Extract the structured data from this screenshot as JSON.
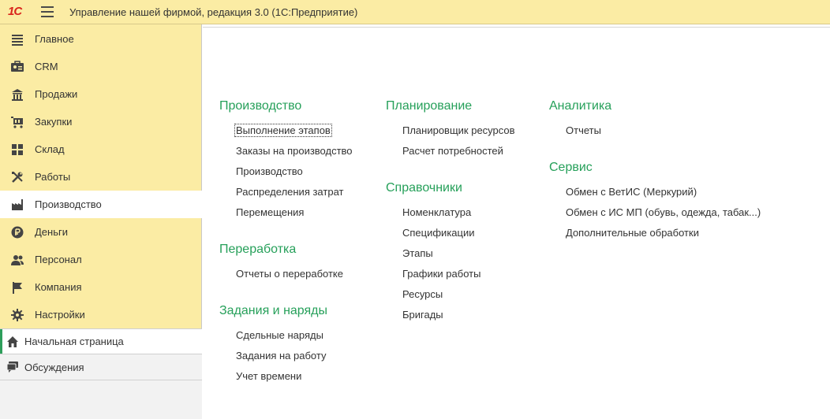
{
  "app": {
    "logo_text": "1С",
    "title": "Управление нашей фирмой, редакция 3.0  (1С:Предприятие)"
  },
  "sidebar": {
    "items": [
      {
        "label": "Главное",
        "icon": "list-icon"
      },
      {
        "label": "CRM",
        "icon": "crm-icon"
      },
      {
        "label": "Продажи",
        "icon": "store-icon"
      },
      {
        "label": "Закупки",
        "icon": "cart-icon"
      },
      {
        "label": "Склад",
        "icon": "warehouse-icon"
      },
      {
        "label": "Работы",
        "icon": "tools-icon"
      },
      {
        "label": "Производство",
        "icon": "factory-icon",
        "active": true
      },
      {
        "label": "Деньги",
        "icon": "ruble-icon"
      },
      {
        "label": "Персонал",
        "icon": "people-icon"
      },
      {
        "label": "Компания",
        "icon": "flag-icon"
      },
      {
        "label": "Настройки",
        "icon": "gear-icon"
      }
    ],
    "home_label": "Начальная страница",
    "discussions_label": "Обсуждения"
  },
  "sections": {
    "production": {
      "title": "Производство",
      "links": [
        "Выполнение этапов",
        "Заказы на производство",
        "Производство",
        "Распределения затрат",
        "Перемещения"
      ]
    },
    "processing": {
      "title": "Переработка",
      "links": [
        "Отчеты о переработке"
      ]
    },
    "tasks": {
      "title": "Задания и наряды",
      "links": [
        "Сдельные наряды",
        "Задания на работу",
        "Учет времени"
      ]
    },
    "planning": {
      "title": "Планирование",
      "links": [
        "Планировщик ресурсов",
        "Расчет потребностей"
      ]
    },
    "references": {
      "title": "Справочники",
      "links": [
        "Номенклатура",
        "Спецификации",
        "Этапы",
        "Графики работы",
        "Ресурсы",
        "Бригады"
      ]
    },
    "analytics": {
      "title": "Аналитика",
      "links": [
        "Отчеты"
      ]
    },
    "service": {
      "title": "Сервис",
      "links": [
        "Обмен с ВетИС (Меркурий)",
        "Обмен с ИС МП (обувь, одежда, табак...)",
        "Дополнительные обработки"
      ]
    }
  },
  "colors": {
    "sidebar_bg": "#fbeca4",
    "section_heading": "#26a05a",
    "logo_red": "#d9251c",
    "accent_green": "#2e9e5b"
  }
}
